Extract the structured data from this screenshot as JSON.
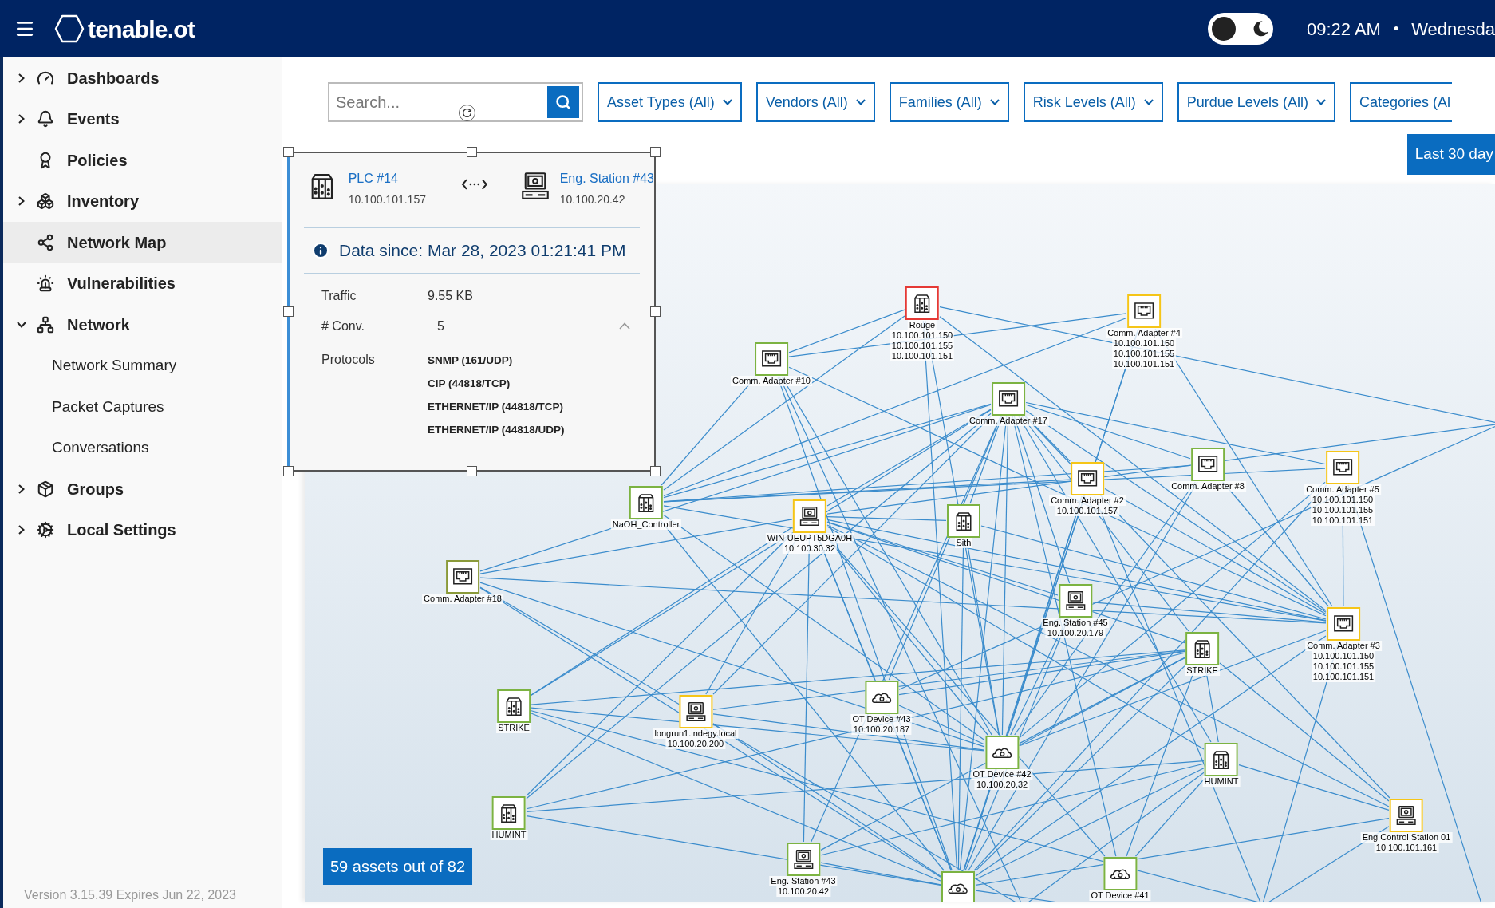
{
  "header": {
    "brand": "tenable.ot",
    "dark_mode": false,
    "time": "09:22 AM",
    "separator": "•",
    "day": "Wednesda"
  },
  "sidebar": {
    "items": [
      {
        "label": "Dashboards",
        "expanded": false,
        "selected": false
      },
      {
        "label": "Events",
        "expanded": false,
        "selected": false
      },
      {
        "label": "Policies",
        "selected": false
      },
      {
        "label": "Inventory",
        "expanded": false,
        "selected": false
      },
      {
        "label": "Network Map",
        "selected": true
      },
      {
        "label": "Vulnerabilities",
        "selected": false
      },
      {
        "label": "Network",
        "expanded": true,
        "selected": false,
        "children": [
          {
            "label": "Network Summary",
            "selected": false
          },
          {
            "label": "Packet Captures",
            "selected": false
          },
          {
            "label": "Conversations",
            "selected": false
          }
        ]
      },
      {
        "label": "Groups",
        "expanded": false,
        "selected": false
      },
      {
        "label": "Local Settings",
        "expanded": false,
        "selected": false
      }
    ],
    "footer": "Version 3.15.39 Expires Jun 22, 2023"
  },
  "filters": {
    "search": {
      "placeholder": "Search..."
    },
    "dropdowns": [
      "Asset Types (All)",
      "Vendors (All)",
      "Families (All)",
      "Risk Levels (All)",
      "Purdue Levels (All)",
      "Categories (Al"
    ],
    "date_range": "Last 30 day"
  },
  "popup": {
    "source": {
      "name": "PLC #14",
      "ip": "10.100.101.157",
      "kind": "plc"
    },
    "target": {
      "name": "Eng. Station #43",
      "ip": "10.100.20.42",
      "kind": "station"
    },
    "data_since": "Data since: Mar 28, 2023 01:21:41 PM",
    "rows": [
      {
        "label": "Traffic",
        "value": "9.55 KB"
      },
      {
        "label": "# Conv.",
        "value": "5",
        "expanded": true
      }
    ],
    "protocols": {
      "label": "Protocols",
      "values": [
        "SNMP (161/UDP)",
        "CIP (44818/TCP)",
        "ETHERNET/IP (44818/TCP)",
        "ETHERNET/IP (44818/UDP)"
      ]
    }
  },
  "map": {
    "nodes": [
      {
        "lines": [
          "Rouge",
          "10.100.101.150",
          "10.100.101.155",
          "10.100.101.151"
        ],
        "kind": "plc",
        "color": "#e53935"
      },
      {
        "lines": [
          "Comm. Adapter #4",
          "10.100.101.150",
          "10.100.101.155",
          "10.100.101.151"
        ],
        "kind": "adapter",
        "color": "#f5c518"
      },
      {
        "lines": [
          "Comm. Adapter #10"
        ],
        "kind": "adapter",
        "color": "#7cb342"
      },
      {
        "lines": [
          "Comm. Adapter #17"
        ],
        "kind": "adapter",
        "color": "#7cb342"
      },
      {
        "lines": [
          "Comm. Adapter #2",
          "10.100.101.157"
        ],
        "kind": "adapter",
        "color": "#f5c518"
      },
      {
        "lines": [
          "Comm. Adapter #8"
        ],
        "kind": "adapter",
        "color": "#7cb342"
      },
      {
        "lines": [
          "Comm. Adapter #5",
          "10.100.101.150",
          "10.100.101.155",
          "10.100.101.151"
        ],
        "kind": "adapter",
        "color": "#f5c518"
      },
      {
        "lines": [
          "NaOH_Controller"
        ],
        "kind": "plc",
        "color": "#7cb342"
      },
      {
        "lines": [
          "WIN-UEUPT5DGA0H",
          "10.100.30.32"
        ],
        "kind": "station",
        "color": "#f5c518"
      },
      {
        "lines": [
          "Sith"
        ],
        "kind": "plc",
        "color": "#7cb342"
      },
      {
        "lines": [
          "Comm. Adapter #18"
        ],
        "kind": "adapter",
        "color": "#8a9a3a"
      },
      {
        "lines": [
          "Eng. Station #45",
          "10.100.20.179"
        ],
        "kind": "station",
        "color": "#7cb342"
      },
      {
        "lines": [
          "Comm. Adapter #3",
          "10.100.101.150",
          "10.100.101.155",
          "10.100.101.151"
        ],
        "kind": "adapter",
        "color": "#f5c518"
      },
      {
        "lines": [
          "STRIKE"
        ],
        "kind": "plc",
        "color": "#7cb342"
      },
      {
        "lines": [
          "STRIKE"
        ],
        "kind": "plc",
        "color": "#7cb342"
      },
      {
        "lines": [
          "longrun1.indegy.local",
          "10.100.20.200"
        ],
        "kind": "station",
        "color": "#f5c518"
      },
      {
        "lines": [
          "OT Device #43",
          "10.100.20.187"
        ],
        "kind": "device",
        "color": "#7cb342"
      },
      {
        "lines": [
          "OT Device #42",
          "10.100.20.32"
        ],
        "kind": "device",
        "color": "#7cb342"
      },
      {
        "lines": [
          "HUMINT"
        ],
        "kind": "plc",
        "color": "#7cb342"
      },
      {
        "lines": [
          "HUMINT"
        ],
        "kind": "plc",
        "color": "#7cb342"
      },
      {
        "lines": [
          "Eng Control Station 01",
          "10.100.101.161"
        ],
        "kind": "station",
        "color": "#f5c518"
      },
      {
        "lines": [
          "Eng. Station #43",
          "10.100.20.42"
        ],
        "kind": "station",
        "color": "#7cb342"
      },
      {
        "kind": "device",
        "color": "#7cb342"
      },
      {
        "lines": [
          "OT Device #41"
        ],
        "kind": "device",
        "color": "#7cb342"
      }
    ],
    "asset_count": "59 assets out of 82"
  }
}
